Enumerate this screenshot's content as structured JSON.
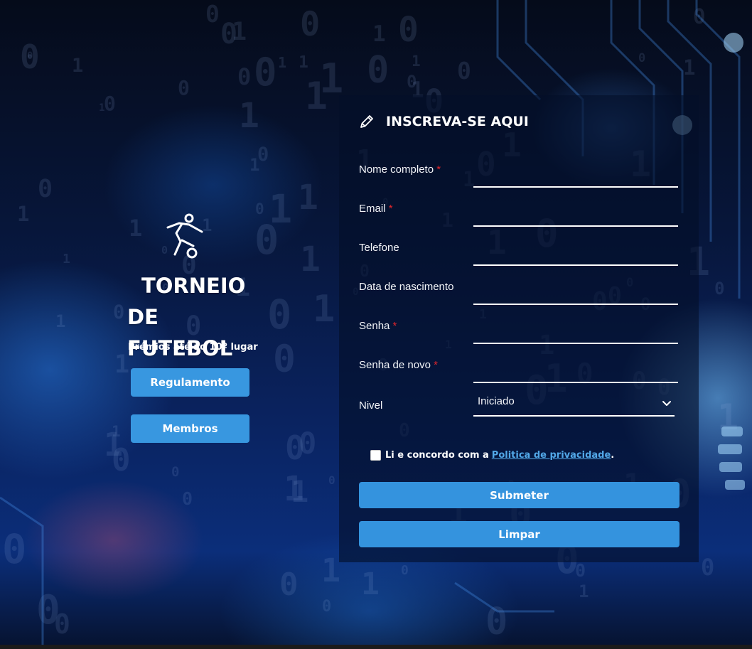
{
  "brand": {
    "icon": "soccer-player-icon",
    "title_line1": "TORNEIO",
    "title_line2": "DE FUTEBOL",
    "subtitle": "Prémios até ao 10º lugar",
    "buttons": [
      {
        "label": "Regulamento"
      },
      {
        "label": "Membros"
      }
    ]
  },
  "form": {
    "icon": "pencil-icon",
    "title": "INSCREVA-SE AQUI",
    "required_marker": "*",
    "fields": [
      {
        "label": "Nome completo",
        "required": true,
        "value": ""
      },
      {
        "label": "Email",
        "required": true,
        "value": ""
      },
      {
        "label": "Telefone",
        "required": false,
        "value": ""
      },
      {
        "label": "Data de nascimento",
        "required": false,
        "value": ""
      },
      {
        "label": "Senha",
        "required": true,
        "value": ""
      },
      {
        "label": "Senha de novo",
        "required": true,
        "value": ""
      }
    ],
    "level": {
      "label": "Nivel",
      "selected": "Iniciado"
    },
    "consent": {
      "text": "Li e concordo com a",
      "link": "Politica de privacidade",
      "suffix": ".",
      "checked": false
    },
    "submit_label": "Submeter",
    "clear_label": "Limpar"
  },
  "colors": {
    "button": "#3493de",
    "required": "#e0262b",
    "link": "#52a8e8"
  }
}
